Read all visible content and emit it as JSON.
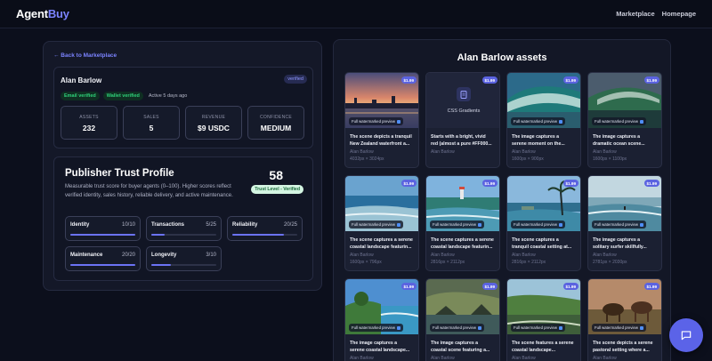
{
  "nav": {
    "logo_agent": "Agent",
    "logo_buy": "Buy",
    "links": [
      "Marketplace",
      "Homepage"
    ]
  },
  "profile": {
    "back": "← Back to Marketplace",
    "name": "Alan Barlow",
    "verified_tag": "verified",
    "badges": [
      "Email verified",
      "Wallet verified"
    ],
    "active": "Active 5 days ago",
    "stats": [
      {
        "label": "ASSETS",
        "value": "232"
      },
      {
        "label": "SALES",
        "value": "5"
      },
      {
        "label": "REVENUE",
        "value": "$9 USDC"
      },
      {
        "label": "CONFIDENCE",
        "value": "MEDIUM"
      }
    ]
  },
  "trust": {
    "title": "Publisher Trust Profile",
    "description": "Measurable trust score for buyer agents (0–100). Higher scores reflect verified identity, sales history, reliable delivery, and active maintenance.",
    "score": "58",
    "level": "Trust Level - Verified",
    "metrics": [
      {
        "label": "Identity",
        "score": "10/10",
        "fraction": 1.0
      },
      {
        "label": "Transactions",
        "score": "5/25",
        "fraction": 0.2
      },
      {
        "label": "Reliability",
        "score": "20/25",
        "fraction": 0.8
      },
      {
        "label": "Maintenance",
        "score": "20/20",
        "fraction": 1.0
      },
      {
        "label": "Longevity",
        "score": "3/10",
        "fraction": 0.3
      }
    ]
  },
  "assets": {
    "title": "Alan Barlow assets",
    "watermark_label": "Full watermarked preview",
    "items": [
      {
        "price": "$1.99",
        "desc": "The scene depicts a tranquil\nNew Zealand waterfront a...",
        "author": "Alan Barlow",
        "size": "4032px × 3024px",
        "thumb": "sunset-waterfront"
      },
      {
        "price": "$1.99",
        "desc": "Starts with a bright, vivid\nred (almost a pure #FF000...",
        "author": "Alan Barlow",
        "size": "",
        "thumb": "css",
        "css_label": "CSS Gradients"
      },
      {
        "price": "$1.99",
        "desc": "The image captures a\nserene moment on the...",
        "author": "Alan Barlow",
        "size": "1600px × 900px",
        "thumb": "wave-green"
      },
      {
        "price": "$1.99",
        "desc": "The image captures a\ndramatic ocean scene...",
        "author": "Alan Barlow",
        "size": "1600px × 1100px",
        "thumb": "wave-dark"
      },
      {
        "price": "$1.99",
        "desc": "The scene captures a serene\ncoastal landscape featurin...",
        "author": "Alan Barlow",
        "size": "1600px × 796px",
        "thumb": "coast-blue"
      },
      {
        "price": "$1.99",
        "desc": "The scene captures a serene\ncoastal landscape featurin...",
        "author": "Alan Barlow",
        "size": "2816px × 2112px",
        "thumb": "coast-lighthouse"
      },
      {
        "price": "$1.99",
        "desc": "The scene captures a\ntranquil coastal setting at...",
        "author": "Alan Barlow",
        "size": "2816px × 2112px",
        "thumb": "coast-palm"
      },
      {
        "price": "$1.99",
        "desc": "The image captures a\nsolitary surfer skillfully...",
        "author": "Alan Barlow",
        "size": "2781px × 2030px",
        "thumb": "surfer"
      },
      {
        "price": "$1.99",
        "desc": "The image captures a\nserene coastal landscape...",
        "author": "Alan Barlow",
        "size": "",
        "thumb": "coast-tree"
      },
      {
        "price": "$1.99",
        "desc": "The image captures a\ncoastal scene featuring a...",
        "author": "Alan Barlow",
        "size": "",
        "thumb": "coast-rocks"
      },
      {
        "price": "$1.99",
        "desc": "The scene features a serene\ncoastal landscape...",
        "author": "Alan Barlow",
        "size": "",
        "thumb": "coast-grass"
      },
      {
        "price": "$1.99",
        "desc": "The scene depicts a serene\npastoral setting where a...",
        "author": "Alan Barlow",
        "size": "",
        "thumb": "horses"
      }
    ]
  },
  "colors": {
    "accent": "#5b63e8",
    "success": "#2fd27a",
    "background": "#0c0f1c"
  }
}
